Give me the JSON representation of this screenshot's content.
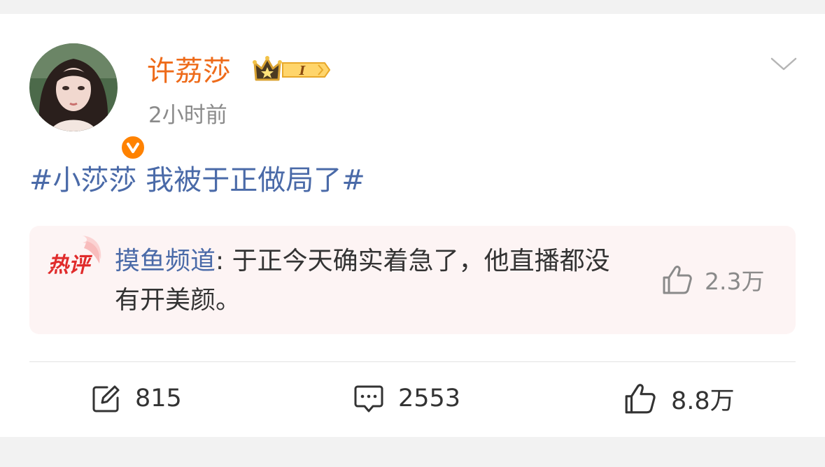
{
  "post": {
    "username": "许荔莎",
    "vip_level": "I",
    "time": "2小时前",
    "topic": "#小莎莎 我被于正做局了#"
  },
  "hot_comment": {
    "badge": "热评",
    "author": "摸鱼频道",
    "separator": ": ",
    "text": "于正今天确实着急了，他直播都没有开美颜。",
    "likes": "2.3万"
  },
  "actions": {
    "reposts": "815",
    "comments": "2553",
    "likes": "8.8万"
  },
  "colors": {
    "username": "#ee6b1a",
    "topic": "#4a6aa8",
    "verified": "#ff8200",
    "hot_bg": "#fdf4f4"
  }
}
